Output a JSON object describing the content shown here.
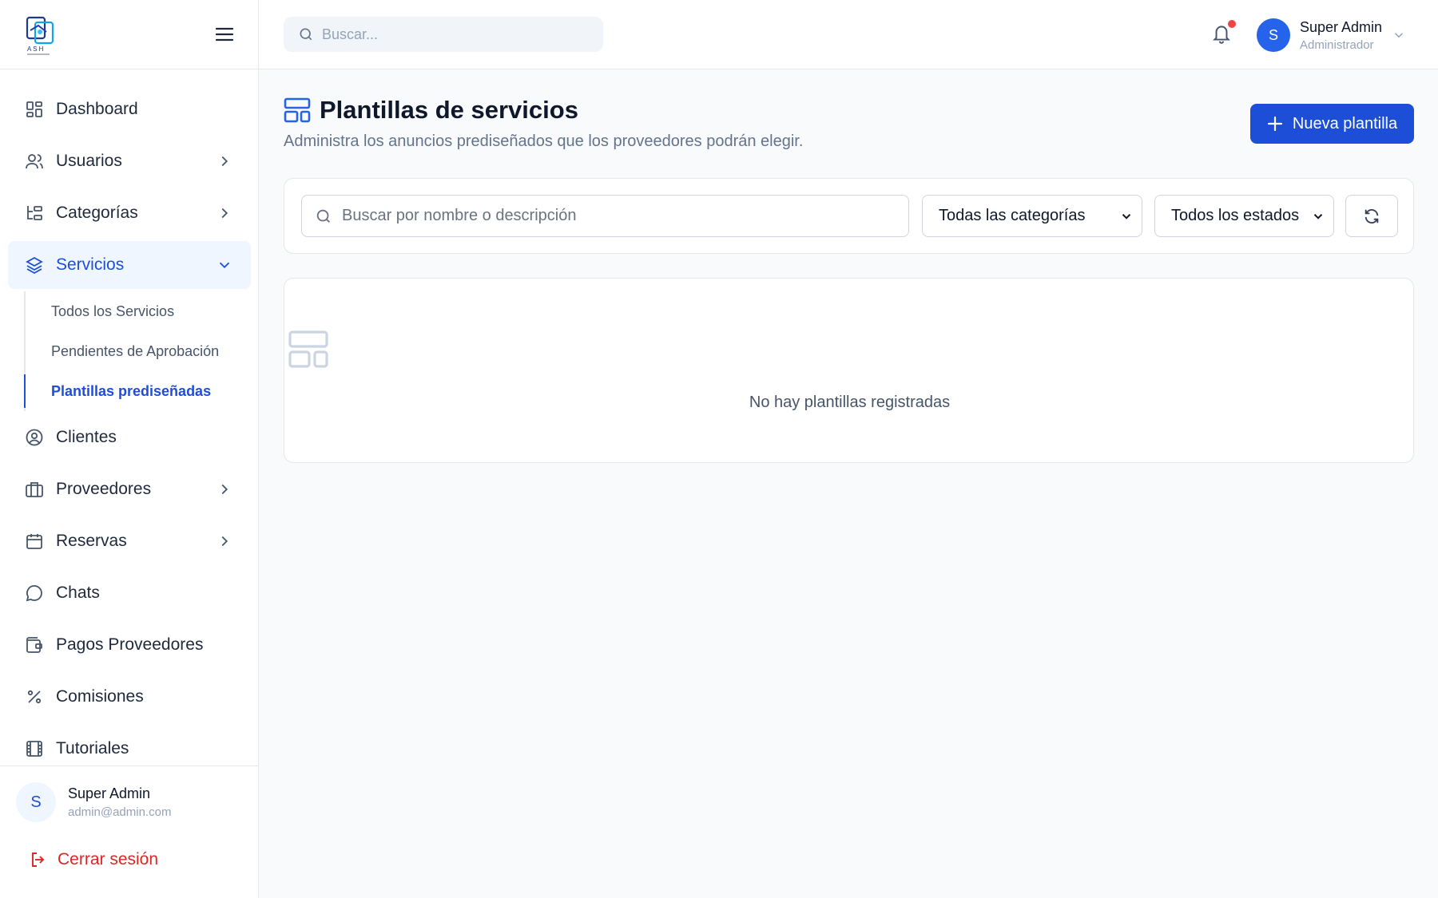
{
  "brand": {
    "logo_text": "A S H"
  },
  "topbar": {
    "search_placeholder": "Buscar...",
    "user_initial": "S",
    "user_name": "Super Admin",
    "user_role": "Administrador"
  },
  "sidebar": {
    "items": [
      {
        "label": "Dashboard",
        "icon": "dashboard-icon",
        "has_chevron": false
      },
      {
        "label": "Usuarios",
        "icon": "users-icon",
        "has_chevron": true
      },
      {
        "label": "Categorías",
        "icon": "categories-icon",
        "has_chevron": true
      },
      {
        "label": "Servicios",
        "icon": "layers-icon",
        "has_chevron": true,
        "active": true
      },
      {
        "label": "Clientes",
        "icon": "user-circle-icon",
        "has_chevron": false
      },
      {
        "label": "Proveedores",
        "icon": "briefcase-icon",
        "has_chevron": true
      },
      {
        "label": "Reservas",
        "icon": "calendar-icon",
        "has_chevron": true
      },
      {
        "label": "Chats",
        "icon": "chat-icon",
        "has_chevron": false
      },
      {
        "label": "Pagos Proveedores",
        "icon": "wallet-icon",
        "has_chevron": false
      },
      {
        "label": "Comisiones",
        "icon": "percent-icon",
        "has_chevron": false
      },
      {
        "label": "Tutoriales",
        "icon": "film-icon",
        "has_chevron": false
      }
    ],
    "subitems": [
      {
        "label": "Todos los Servicios"
      },
      {
        "label": "Pendientes de Aprobación"
      },
      {
        "label": "Plantillas prediseñadas",
        "active": true
      }
    ],
    "footer": {
      "initial": "S",
      "name": "Super Admin",
      "email": "admin@admin.com",
      "logout_label": "Cerrar sesión"
    }
  },
  "page": {
    "title": "Plantillas de servicios",
    "subtitle": "Administra los anuncios prediseñados que los proveedores podrán elegir.",
    "new_button_label": "Nueva plantilla"
  },
  "filters": {
    "search_placeholder": "Buscar por nombre o descripción",
    "category_selected": "Todas las categorías",
    "status_selected": "Todos los estados"
  },
  "empty_state": {
    "message": "No hay plantillas registradas"
  },
  "colors": {
    "accent": "#1d4ed8",
    "danger": "#dc2626",
    "notification": "#ef4444"
  }
}
